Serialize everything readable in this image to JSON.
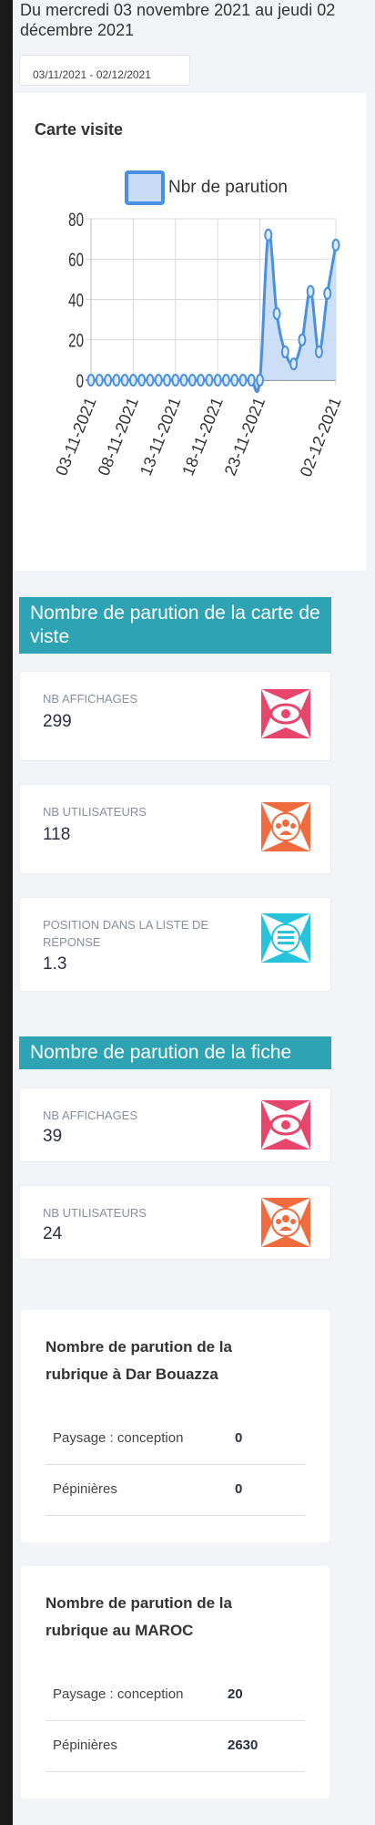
{
  "header": {
    "date_text": "Du mercredi 03 novembre 2021 au jeudi 02 décembre 2021",
    "date_range": "03/11/2021 - 02/12/2021"
  },
  "chart": {
    "title": "Carte visite",
    "legend": "Nbr de parution",
    "line_color": "#4a90e2",
    "fill_color": "#c8dcf6"
  },
  "chart_data": {
    "type": "line",
    "title": "Carte visite",
    "series": [
      {
        "name": "Nbr de parution",
        "values": [
          0,
          0,
          0,
          0,
          0,
          0,
          0,
          0,
          0,
          0,
          0,
          0,
          0,
          0,
          0,
          0,
          0,
          0,
          0,
          0,
          0,
          72,
          33,
          14,
          8,
          20,
          44,
          14,
          43,
          67
        ]
      }
    ],
    "x": [
      "03-11-2021",
      "04-11-2021",
      "05-11-2021",
      "06-11-2021",
      "07-11-2021",
      "08-11-2021",
      "09-11-2021",
      "10-11-2021",
      "11-11-2021",
      "12-11-2021",
      "13-11-2021",
      "14-11-2021",
      "15-11-2021",
      "16-11-2021",
      "17-11-2021",
      "18-11-2021",
      "19-11-2021",
      "20-11-2021",
      "21-11-2021",
      "22-11-2021",
      "23-11-2021",
      "24-11-2021",
      "25-11-2021",
      "26-11-2021",
      "27-11-2021",
      "28-11-2021",
      "29-11-2021",
      "30-11-2021",
      "01-12-2021",
      "02-12-2021"
    ],
    "xticks": [
      "03-11-2021",
      "08-11-2021",
      "13-11-2021",
      "18-11-2021",
      "23-11-2021",
      "02-12-2021"
    ],
    "yticks": [
      0,
      20,
      40,
      60,
      80
    ],
    "ylim": [
      0,
      80
    ],
    "grid": true,
    "legend_position": "top"
  },
  "section_carte": {
    "title": "Nombre de parution de la carte de viste",
    "stats": [
      {
        "label": "NB AFFICHAGES",
        "value": "299",
        "icon": "eye-icon",
        "color": "#e8456c"
      },
      {
        "label": "NB UTILISATEURS",
        "value": "118",
        "icon": "users-icon",
        "color": "#f06b3e"
      },
      {
        "label": "POSITION DANS LA LISTE DE RÉPONSE",
        "value": "1.3",
        "icon": "list-icon",
        "color": "#27c3dc"
      }
    ]
  },
  "section_fiche": {
    "title": "Nombre de parution de la fiche",
    "stats": [
      {
        "label": "NB AFFICHAGES",
        "value": "39",
        "icon": "eye-icon",
        "color": "#e8456c"
      },
      {
        "label": "NB UTILISATEURS",
        "value": "24",
        "icon": "users-icon",
        "color": "#f06b3e"
      }
    ]
  },
  "rubrique_local": {
    "title": "Nombre de parution de la rubrique à Dar Bouazza",
    "rows": [
      {
        "name": "Paysage : conception",
        "value": "0"
      },
      {
        "name": "Pépinières",
        "value": "0"
      }
    ]
  },
  "rubrique_maroc": {
    "title": "Nombre de parution de la rubrique au MAROC",
    "rows": [
      {
        "name": "Paysage : conception",
        "value": "20"
      },
      {
        "name": "Pépinières",
        "value": "2630"
      }
    ]
  }
}
